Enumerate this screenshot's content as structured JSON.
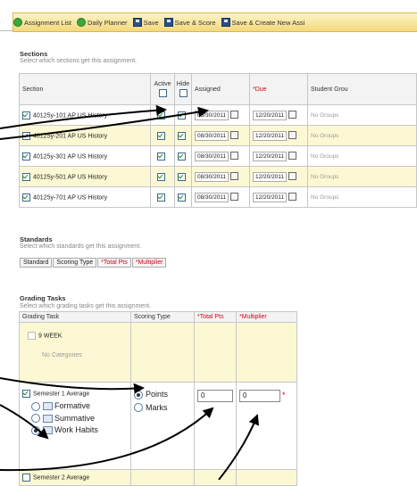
{
  "toolbar": {
    "items": [
      {
        "label": "Assignment List",
        "icon": "green-circle-icon"
      },
      {
        "label": "Daily Planner",
        "icon": "green-circle-icon"
      },
      {
        "label": "Save",
        "icon": "save-disk-icon"
      },
      {
        "label": "Save & Score",
        "icon": "save-disk-icon"
      },
      {
        "label": "Save & Create New Assi",
        "icon": "save-disk-icon"
      }
    ]
  },
  "sections": {
    "title": "Sections",
    "subtitle": "Select which sections get this assignment.",
    "headers": {
      "section": "Section",
      "active": "Active",
      "hide": "Hide",
      "assigned": "Assigned",
      "due": "*Due",
      "groups": "Student Grou"
    },
    "rows": [
      {
        "name": "40125y-101 AP US History",
        "assigned": "08/30/2011",
        "due": "12/20/2011",
        "groups": "No Groups"
      },
      {
        "name": "40125y-201 AP US History",
        "assigned": "08/30/2011",
        "due": "12/20/2011",
        "groups": "No Groups"
      },
      {
        "name": "40125y-301 AP US History",
        "assigned": "08/30/2011",
        "due": "12/20/2011",
        "groups": "No Groups"
      },
      {
        "name": "40125y-501 AP US History",
        "assigned": "08/30/2011",
        "due": "12/20/2011",
        "groups": "No Groups"
      },
      {
        "name": "40125y-701 AP US History",
        "assigned": "08/30/2011",
        "due": "12/20/2011",
        "groups": "No Groups"
      }
    ]
  },
  "standards": {
    "title": "Standards",
    "subtitle": "Select which standards get this assignment.",
    "headers": [
      "Standard",
      "Scoring Type",
      "*Total Pts",
      "*Multiplier"
    ]
  },
  "grading": {
    "title": "Grading Tasks",
    "subtitle": "Select which grading tasks get this assignment.",
    "headers": {
      "task": "Grading Task",
      "scoring": "Scoring Type",
      "total": "*Total Pts",
      "mult": "*Multiplier"
    },
    "week": {
      "label": "9 WEEK",
      "note": "No Categories"
    },
    "semester1": {
      "label": "Semester 1 Average",
      "categories": [
        "Formative",
        "Summative",
        "Work Habits"
      ],
      "scoring_options": [
        "Points",
        "Marks"
      ],
      "total": "0",
      "mult": "0",
      "required_mark": "*"
    },
    "semester2": {
      "label": "Semester 2 Average"
    }
  }
}
